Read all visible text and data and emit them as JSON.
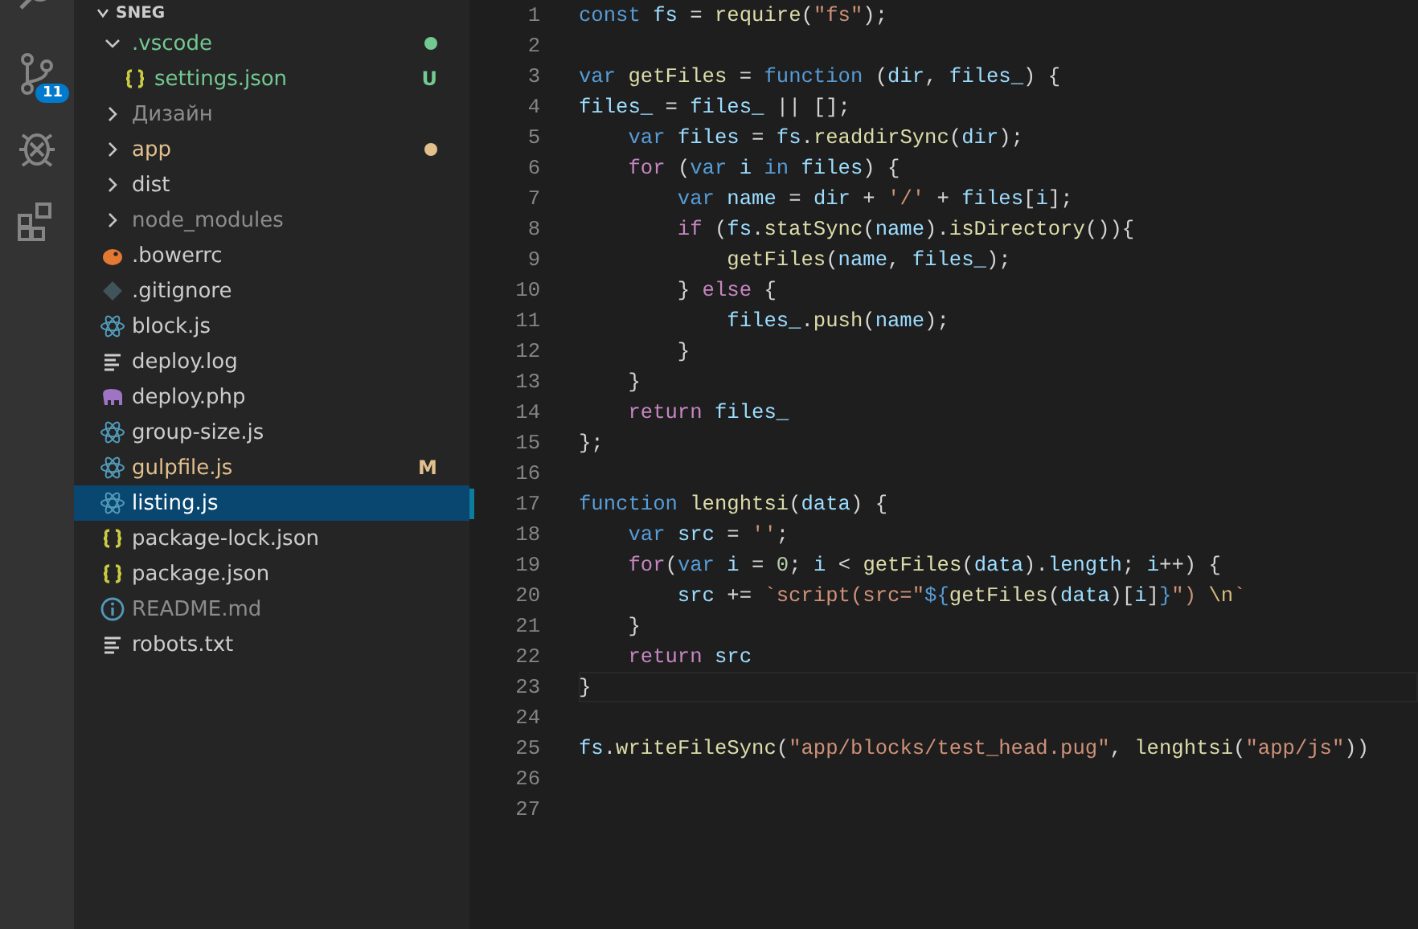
{
  "activity_bar": [
    {
      "kind": "search"
    },
    {
      "kind": "source-control",
      "badge": "11"
    },
    {
      "kind": "debug"
    },
    {
      "kind": "extensions"
    }
  ],
  "explorer": {
    "folder_title": "SNEG",
    "items": [
      {
        "name": ".vscode",
        "kind": "folder",
        "expanded": true,
        "selected": false,
        "dot": true,
        "color": "#73c991",
        "children": [
          {
            "name": "settings.json",
            "kind": "braces",
            "selected": false,
            "dot": false,
            "color": "#73c991",
            "badge": "U"
          }
        ]
      },
      {
        "name": "Дизайн",
        "kind": "folder",
        "expanded": false,
        "selected": false,
        "dot": false,
        "color": "#8c8c8c"
      },
      {
        "name": "app",
        "kind": "folder",
        "expanded": false,
        "selected": false,
        "dot": true,
        "color": "#e2c08d"
      },
      {
        "name": "dist",
        "kind": "folder",
        "expanded": false,
        "selected": false,
        "dot": false,
        "color": "#cccccc"
      },
      {
        "name": "node_modules",
        "kind": "folder",
        "expanded": false,
        "selected": false,
        "dot": false,
        "color": "#8c8c8c"
      },
      {
        "name": ".bowerrc",
        "kind": "bird",
        "selected": false,
        "dot": false,
        "color": "#cccccc"
      },
      {
        "name": ".gitignore",
        "kind": "diamond",
        "selected": false,
        "dot": false,
        "color": "#cccccc"
      },
      {
        "name": "block.js",
        "kind": "atom",
        "selected": false,
        "dot": false,
        "color": "#cccccc"
      },
      {
        "name": "deploy.log",
        "kind": "text",
        "selected": false,
        "dot": false,
        "color": "#cccccc"
      },
      {
        "name": "deploy.php",
        "kind": "elephant",
        "selected": false,
        "dot": false,
        "color": "#cccccc"
      },
      {
        "name": "group-size.js",
        "kind": "atom",
        "selected": false,
        "dot": false,
        "color": "#cccccc"
      },
      {
        "name": "gulpfile.js",
        "kind": "atom",
        "selected": false,
        "dot": false,
        "color": "#e2c08d",
        "badge": "M"
      },
      {
        "name": "listing.js",
        "kind": "atom",
        "selected": true,
        "dot": false,
        "color": "#ffffff"
      },
      {
        "name": "package-lock.json",
        "kind": "braces",
        "selected": false,
        "dot": false,
        "color": "#cccccc"
      },
      {
        "name": "package.json",
        "kind": "braces",
        "selected": false,
        "dot": false,
        "color": "#cccccc"
      },
      {
        "name": "README.md",
        "kind": "info",
        "selected": false,
        "dot": false,
        "color": "#8c8c8c"
      },
      {
        "name": "robots.txt",
        "kind": "text",
        "selected": false,
        "dot": false,
        "color": "#cccccc"
      }
    ]
  },
  "editor": {
    "lines": [
      {
        "number": "1",
        "tokens": [
          {
            "kind": "kw",
            "text": "const"
          },
          {
            "kind": "var",
            "text": " fs"
          },
          {
            "kind": "plain",
            "text": " = "
          },
          {
            "kind": "fn",
            "text": "require"
          },
          {
            "kind": "plain",
            "text": "("
          },
          {
            "kind": "str",
            "text": "\"fs\""
          },
          {
            "kind": "plain",
            "text": ");"
          }
        ]
      },
      {
        "number": "2"
      },
      {
        "number": "3",
        "tokens": [
          {
            "kind": "kw",
            "text": "var"
          },
          {
            "kind": "fn",
            "text": " getFiles"
          },
          {
            "kind": "plain",
            "text": " = "
          },
          {
            "kind": "kw",
            "text": "function"
          },
          {
            "kind": "plain",
            "text": " ("
          },
          {
            "kind": "var",
            "text": "dir"
          },
          {
            "kind": "plain",
            "text": ", "
          },
          {
            "kind": "var",
            "text": "files_"
          },
          {
            "kind": "plain",
            "text": ") {"
          }
        ]
      },
      {
        "number": "4",
        "tokens": [
          {
            "kind": "var",
            "text": "files_"
          },
          {
            "kind": "plain",
            "text": " = "
          },
          {
            "kind": "var",
            "text": "files_"
          },
          {
            "kind": "plain",
            "text": " || [];"
          }
        ]
      },
      {
        "number": "5",
        "tokens": [
          {
            "kind": "kw",
            "text": "    var"
          },
          {
            "kind": "var",
            "text": " files"
          },
          {
            "kind": "plain",
            "text": " = "
          },
          {
            "kind": "var",
            "text": "fs"
          },
          {
            "kind": "plain",
            "text": "."
          },
          {
            "kind": "fn",
            "text": "readdirSync"
          },
          {
            "kind": "plain",
            "text": "("
          },
          {
            "kind": "var",
            "text": "dir"
          },
          {
            "kind": "plain",
            "text": ");"
          }
        ]
      },
      {
        "number": "6",
        "tokens": [
          {
            "kind": "ctl",
            "text": "    for"
          },
          {
            "kind": "plain",
            "text": " ("
          },
          {
            "kind": "kw",
            "text": "var"
          },
          {
            "kind": "var",
            "text": " i"
          },
          {
            "kind": "kw",
            "text": " in"
          },
          {
            "kind": "var",
            "text": " files"
          },
          {
            "kind": "plain",
            "text": ") {"
          }
        ]
      },
      {
        "number": "7",
        "tokens": [
          {
            "kind": "kw",
            "text": "        var"
          },
          {
            "kind": "var",
            "text": " name"
          },
          {
            "kind": "plain",
            "text": " = "
          },
          {
            "kind": "var",
            "text": "dir"
          },
          {
            "kind": "plain",
            "text": " + "
          },
          {
            "kind": "str",
            "text": "'/'"
          },
          {
            "kind": "plain",
            "text": " + "
          },
          {
            "kind": "var",
            "text": "files"
          },
          {
            "kind": "plain",
            "text": "["
          },
          {
            "kind": "var",
            "text": "i"
          },
          {
            "kind": "plain",
            "text": "];"
          }
        ]
      },
      {
        "number": "8",
        "tokens": [
          {
            "kind": "ctl",
            "text": "        if"
          },
          {
            "kind": "plain",
            "text": " ("
          },
          {
            "kind": "var",
            "text": "fs"
          },
          {
            "kind": "plain",
            "text": "."
          },
          {
            "kind": "fn",
            "text": "statSync"
          },
          {
            "kind": "plain",
            "text": "("
          },
          {
            "kind": "var",
            "text": "name"
          },
          {
            "kind": "plain",
            "text": ")."
          },
          {
            "kind": "fn",
            "text": "isDirectory"
          },
          {
            "kind": "plain",
            "text": "()){"
          }
        ]
      },
      {
        "number": "9",
        "tokens": [
          {
            "kind": "fn",
            "text": "            getFiles"
          },
          {
            "kind": "plain",
            "text": "("
          },
          {
            "kind": "var",
            "text": "name"
          },
          {
            "kind": "plain",
            "text": ", "
          },
          {
            "kind": "var",
            "text": "files_"
          },
          {
            "kind": "plain",
            "text": ");"
          }
        ]
      },
      {
        "number": "10",
        "tokens": [
          {
            "kind": "plain",
            "text": "        } "
          },
          {
            "kind": "ctl",
            "text": "else"
          },
          {
            "kind": "plain",
            "text": " {"
          }
        ]
      },
      {
        "number": "11",
        "tokens": [
          {
            "kind": "var",
            "text": "            files_"
          },
          {
            "kind": "plain",
            "text": "."
          },
          {
            "kind": "fn",
            "text": "push"
          },
          {
            "kind": "plain",
            "text": "("
          },
          {
            "kind": "var",
            "text": "name"
          },
          {
            "kind": "plain",
            "text": ");"
          }
        ]
      },
      {
        "number": "12",
        "tokens": [
          {
            "kind": "plain",
            "text": "        }"
          }
        ]
      },
      {
        "number": "13",
        "tokens": [
          {
            "kind": "plain",
            "text": "    }"
          }
        ]
      },
      {
        "number": "14",
        "tokens": [
          {
            "kind": "ctl",
            "text": "    return"
          },
          {
            "kind": "var",
            "text": " files_"
          }
        ]
      },
      {
        "number": "15",
        "tokens": [
          {
            "kind": "plain",
            "text": "};"
          }
        ]
      },
      {
        "number": "16"
      },
      {
        "number": "17",
        "modified": true,
        "tokens": [
          {
            "kind": "kw",
            "text": "function"
          },
          {
            "kind": "fn",
            "text": " lenghtsi"
          },
          {
            "kind": "plain",
            "text": "("
          },
          {
            "kind": "var",
            "text": "data"
          },
          {
            "kind": "plain",
            "text": ") {"
          }
        ]
      },
      {
        "number": "18",
        "tokens": [
          {
            "kind": "kw",
            "text": "    var"
          },
          {
            "kind": "var",
            "text": " src"
          },
          {
            "kind": "plain",
            "text": " = "
          },
          {
            "kind": "str",
            "text": "''"
          },
          {
            "kind": "plain",
            "text": ";"
          }
        ]
      },
      {
        "number": "19",
        "tokens": [
          {
            "kind": "ctl",
            "text": "    for"
          },
          {
            "kind": "plain",
            "text": "("
          },
          {
            "kind": "kw",
            "text": "var"
          },
          {
            "kind": "var",
            "text": " i"
          },
          {
            "kind": "plain",
            "text": " = "
          },
          {
            "kind": "num",
            "text": "0"
          },
          {
            "kind": "plain",
            "text": "; "
          },
          {
            "kind": "var",
            "text": "i"
          },
          {
            "kind": "plain",
            "text": " < "
          },
          {
            "kind": "fn",
            "text": "getFiles"
          },
          {
            "kind": "plain",
            "text": "("
          },
          {
            "kind": "var",
            "text": "data"
          },
          {
            "kind": "plain",
            "text": ")."
          },
          {
            "kind": "var",
            "text": "length"
          },
          {
            "kind": "plain",
            "text": "; "
          },
          {
            "kind": "var",
            "text": "i"
          },
          {
            "kind": "plain",
            "text": "++) {"
          }
        ]
      },
      {
        "number": "20",
        "tokens": [
          {
            "kind": "var",
            "text": "        src"
          },
          {
            "kind": "plain",
            "text": " += "
          },
          {
            "kind": "str",
            "text": "`script(src=\""
          },
          {
            "kind": "kw",
            "text": "${"
          },
          {
            "kind": "fn",
            "text": "getFiles"
          },
          {
            "kind": "plain",
            "text": "("
          },
          {
            "kind": "var",
            "text": "data"
          },
          {
            "kind": "plain",
            "text": ")["
          },
          {
            "kind": "var",
            "text": "i"
          },
          {
            "kind": "plain",
            "text": "]"
          },
          {
            "kind": "kw",
            "text": "}"
          },
          {
            "kind": "str",
            "text": "\") "
          },
          {
            "kind": "esc",
            "text": "\\n"
          },
          {
            "kind": "str",
            "text": "`"
          }
        ]
      },
      {
        "number": "21",
        "tokens": [
          {
            "kind": "plain",
            "text": "    }"
          }
        ]
      },
      {
        "number": "22",
        "tokens": [
          {
            "kind": "ctl",
            "text": "    return"
          },
          {
            "kind": "var",
            "text": " src"
          }
        ]
      },
      {
        "number": "23",
        "current": true,
        "tokens": [
          {
            "kind": "plain",
            "text": "}"
          }
        ]
      },
      {
        "number": "24"
      },
      {
        "number": "25",
        "tokens": [
          {
            "kind": "var",
            "text": "fs"
          },
          {
            "kind": "plain",
            "text": "."
          },
          {
            "kind": "fn",
            "text": "writeFileSync"
          },
          {
            "kind": "plain",
            "text": "("
          },
          {
            "kind": "str",
            "text": "\"app/blocks/test_head.pug\""
          },
          {
            "kind": "plain",
            "text": ", "
          },
          {
            "kind": "fn",
            "text": "lenghtsi"
          },
          {
            "kind": "plain",
            "text": "("
          },
          {
            "kind": "str",
            "text": "\"app/js\""
          },
          {
            "kind": "plain",
            "text": "))"
          }
        ]
      },
      {
        "number": "26"
      },
      {
        "number": "27"
      }
    ]
  }
}
